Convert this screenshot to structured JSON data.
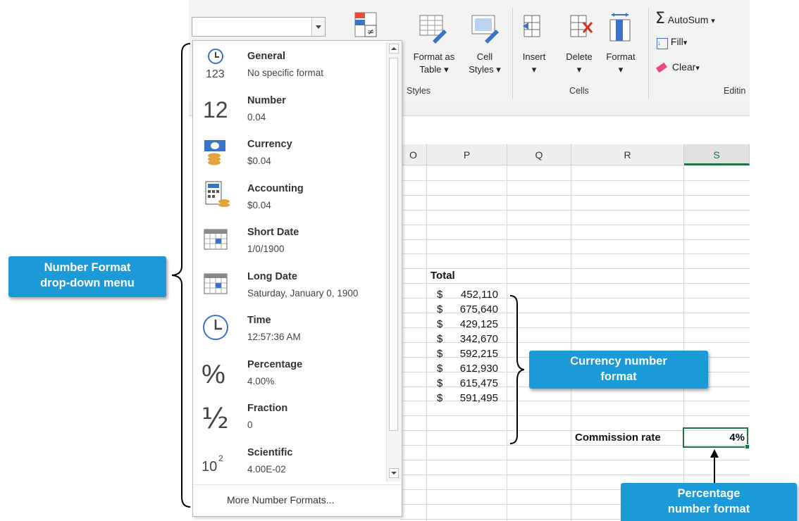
{
  "ribbon": {
    "number_format_value": "",
    "styles": {
      "format_as_table_line1": "Format as",
      "format_as_table_line2": "Table",
      "cell_styles_line1": "Cell",
      "cell_styles_line2": "Styles",
      "group_label": "Styles"
    },
    "cells": {
      "insert": "Insert",
      "delete": "Delete",
      "format": "Format",
      "group_label": "Cells"
    },
    "editing": {
      "autosum": "AutoSum",
      "fill": "Fill",
      "clear": "Clear",
      "group_label": "Editin"
    }
  },
  "number_format_menu": {
    "items": [
      {
        "title": "General",
        "sample": "No specific format",
        "icon": "clock-123-icon"
      },
      {
        "title": "Number",
        "sample": "0.04",
        "icon": "number-12-icon"
      },
      {
        "title": "Currency",
        "sample": "$0.04",
        "icon": "currency-icon"
      },
      {
        "title": "Accounting",
        "sample": " $0.04",
        "icon": "accounting-icon"
      },
      {
        "title": "Short Date",
        "sample": "1/0/1900",
        "icon": "calendar-icon"
      },
      {
        "title": "Long Date",
        "sample": "Saturday, January 0, 1900",
        "icon": "calendar-icon"
      },
      {
        "title": "Time",
        "sample": "12:57:36 AM",
        "icon": "clock-icon"
      },
      {
        "title": "Percentage",
        "sample": "4.00%",
        "icon": "percent-icon"
      },
      {
        "title": "Fraction",
        "sample": "0",
        "icon": "fraction-icon"
      },
      {
        "title": "Scientific",
        "sample": "4.00E-02",
        "icon": "scientific-icon"
      }
    ],
    "more": "More Number Formats...",
    "icon_glyphs": {
      "number": "12",
      "percent": "%",
      "fraction": "½",
      "sci_base": "10",
      "sci_exp": "2",
      "general_digits": "123"
    }
  },
  "sheet": {
    "columns": [
      "O",
      "P",
      "Q",
      "R",
      "S"
    ],
    "selected_column": "S",
    "total_header": "Total",
    "totals": [
      {
        "symbol": "$",
        "amount": "452,110"
      },
      {
        "symbol": "$",
        "amount": "675,640"
      },
      {
        "symbol": "$",
        "amount": "429,125"
      },
      {
        "symbol": "$",
        "amount": "342,670"
      },
      {
        "symbol": "$",
        "amount": "592,215"
      },
      {
        "symbol": "$",
        "amount": "612,930"
      },
      {
        "symbol": "$",
        "amount": "615,475"
      },
      {
        "symbol": "$",
        "amount": "591,495"
      }
    ],
    "commission_label": "Commission rate",
    "commission_value": "4%"
  },
  "callouts": {
    "number_format_line1": "Number Format",
    "number_format_line2": "drop-down menu",
    "currency_line1": "Currency number",
    "currency_line2": "format",
    "percentage_line1": "Percentage",
    "percentage_line2": "number format"
  },
  "colors": {
    "callout": "#1b9ad7",
    "excel_green": "#217346"
  }
}
